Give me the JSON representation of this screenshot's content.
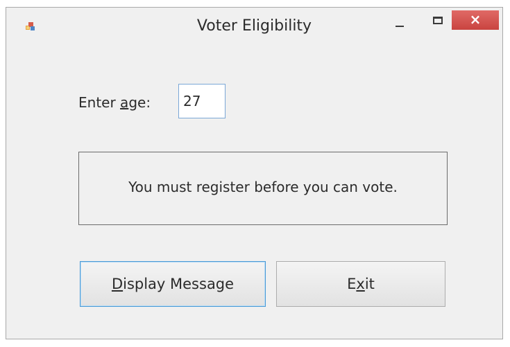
{
  "window": {
    "title": "Voter Eligibility",
    "close_glyph": "×"
  },
  "form": {
    "age_label_before": "Enter ",
    "age_label_mnemonic": "a",
    "age_label_after": "ge:",
    "age_value": "27",
    "message": "You must register before you can vote."
  },
  "buttons": {
    "display_mnemonic": "D",
    "display_rest": "isplay Message",
    "exit_before": "E",
    "exit_mnemonic": "x",
    "exit_after": "it"
  },
  "icons": {
    "app": "app-icon",
    "minimize": "minimize-icon",
    "maximize": "maximize-icon",
    "close": "close-icon"
  },
  "colors": {
    "window_bg": "#f0f0f0",
    "close_button": "#d9534f",
    "focus_border": "#4a9ad6",
    "input_border": "#7aa7d6"
  }
}
